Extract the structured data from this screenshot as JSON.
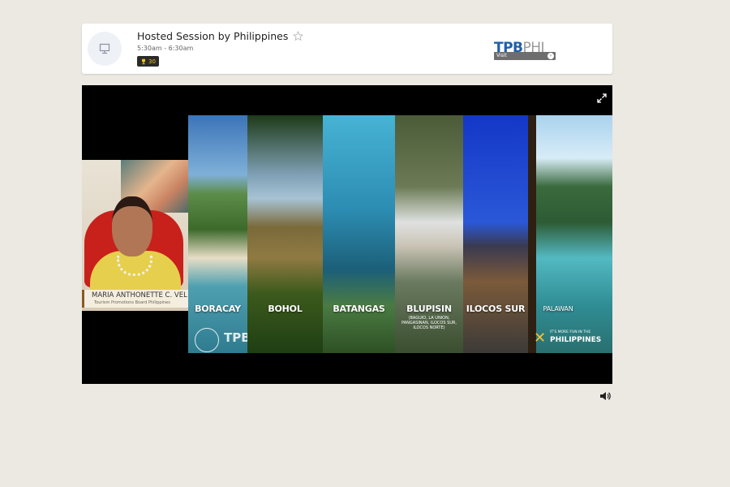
{
  "session": {
    "title": "Hosted Session by Philippines",
    "time": "5:30am - 6:30am",
    "badge_count": "30",
    "logo_text": "TPB",
    "logo_suffix": "PHI",
    "logo_visit": "Visit"
  },
  "video": {
    "speaker_name": "MARIA ANTHONETTE C. VEL",
    "speaker_org": "Tourism Promotions Board Philippines",
    "destinations": [
      {
        "label": "BORACAY",
        "sub": ""
      },
      {
        "label": "BOHOL",
        "sub": ""
      },
      {
        "label": "BATANGAS",
        "sub": ""
      },
      {
        "label": "BLUPISIN",
        "sub": "(BAGUIO, LA UNION,\nPANGASINAN, ILOCOS SUR,\nILOCOS NORTE)"
      },
      {
        "label": "ILOCOS SUR",
        "sub": ""
      },
      {
        "label": "PALAWAN",
        "sub": ""
      }
    ],
    "corner_logo_text": "TPB",
    "tagline_small": "IT'S MORE FUN IN THE",
    "tagline_big": "PHILIPPINES"
  },
  "colors": {
    "page_bg": "#ece8e2",
    "badge_bg": "#2a2a2a",
    "badge_fg": "#f0c419",
    "logo_t": "#1f5fa8",
    "logo_p": "#d6322b",
    "logo_b": "#2b9ad6"
  },
  "icons": [
    "session-icon",
    "star-icon",
    "trophy-icon",
    "fullscreen-icon",
    "volume-icon"
  ]
}
